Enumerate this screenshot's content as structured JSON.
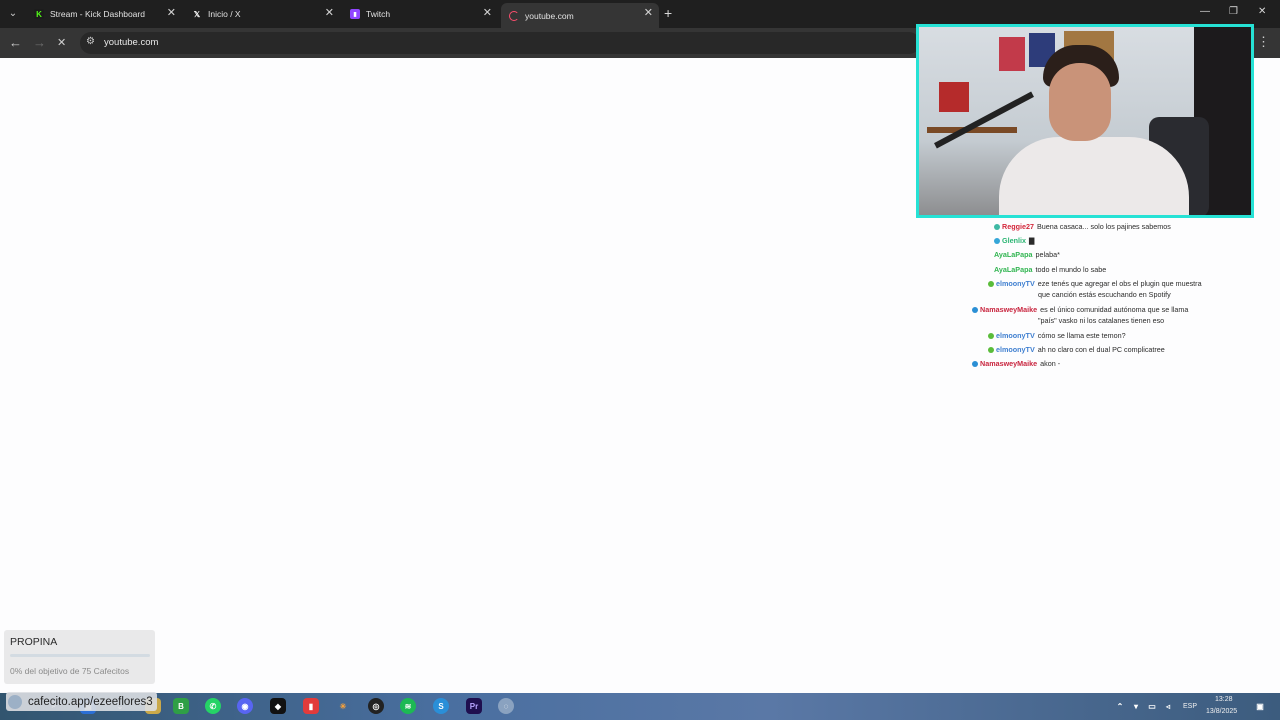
{
  "browser": {
    "tabs": [
      {
        "label": "Stream - Kick Dashboard",
        "favicon": "kick-icon",
        "fav_color": "#53fc18",
        "active": false
      },
      {
        "label": "Inicio / X",
        "favicon": "x-icon",
        "fav_color": "#ffffff",
        "active": false
      },
      {
        "label": "Twitch",
        "favicon": "twitch-icon",
        "fav_color": "#9146ff",
        "active": false
      },
      {
        "label": "youtube.com",
        "favicon": "loading-icon",
        "fav_color": "#ff4e6e",
        "active": true
      }
    ],
    "new_tab_label": "+",
    "url": "youtube.com"
  },
  "chat": [
    {
      "user": "Reggie27",
      "user_color": "#d3283c",
      "badge_color": "#3fb9a4",
      "text": "Buena casaca... solo los pajines sabemos"
    },
    {
      "user": "Glenlix",
      "user_color": "#2bb573",
      "badge_color": "#35a6d8",
      "text": "▇"
    },
    {
      "user": "AyaLaPapa",
      "user_color": "#32b552",
      "badge_color": "",
      "text": "pelaba*"
    },
    {
      "user": "AyaLaPapa",
      "user_color": "#32b552",
      "badge_color": "",
      "text": "todo el mundo lo sabe"
    },
    {
      "user": "elmoonyTV",
      "user_color": "#3f7fd0",
      "badge_color": "#5abc3a",
      "text": "eze tenés que agregar el obs el plugin que muestra",
      "cont": "que canción estás escuchando en Spotify"
    },
    {
      "user": "NamasweyMaike",
      "user_color": "#c8253f",
      "badge_color": "#2b8fd5",
      "text": "es el único comunidad autónoma que se llama",
      "cont": "\"país\" vasko ni los catalanes tienen eso"
    },
    {
      "user": "elmoonyTV",
      "user_color": "#3f7fd0",
      "badge_color": "#5abc3a",
      "text": "cómo se llama este temon?"
    },
    {
      "user": "elmoonyTV",
      "user_color": "#3f7fd0",
      "badge_color": "#5abc3a",
      "text": "ah no claro con el dual PC complicatree"
    },
    {
      "user": "NamasweyMaike",
      "user_color": "#c8253f",
      "badge_color": "#2b8fd5",
      "text": "akon -"
    }
  ],
  "propina": {
    "title": "PROPINA",
    "progress_fraction": 0.0,
    "subtitle": "0% del objetivo de 75 Cafecitos",
    "link": "cafecito.app/ezeeflores3"
  },
  "taskbar": {
    "lang": "ESP",
    "time": "13:28",
    "date": "13/8/2025"
  },
  "colors": {
    "webcam_border": "#26e2d5",
    "tab_bar": "#1f1f1f",
    "toolbar": "#353535"
  }
}
